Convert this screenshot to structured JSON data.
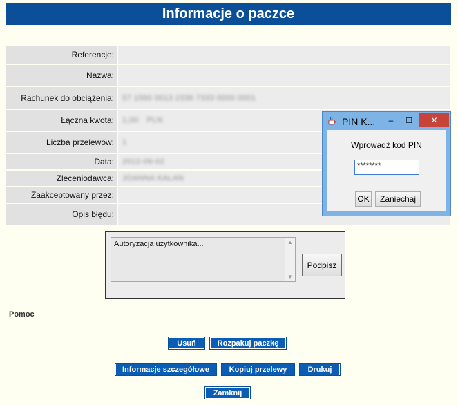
{
  "header": {
    "title": "Informacje o paczce"
  },
  "details": [
    {
      "label": "Referencje:",
      "value": ""
    },
    {
      "label": "Nazwa:",
      "value": ""
    },
    {
      "label": "Rachunek do obciążenia:",
      "value": "57 1560 0013 2336 7333 0000 0001"
    },
    {
      "label": "Łączna kwota:",
      "value": "1,00",
      "currency": "PLN"
    },
    {
      "label": "Liczba przelewów:",
      "value": "1"
    },
    {
      "label": "Data:",
      "value": "2012-06-02"
    },
    {
      "label": "Zleceniodawca:",
      "value": "JOANNA KALAN"
    },
    {
      "label": "Zaakceptowany przez:",
      "value": ""
    },
    {
      "label": "Opis błędu:",
      "value": ""
    }
  ],
  "auth": {
    "status_text": "Autoryzacja użytkownika...",
    "sign_label": "Podpisz"
  },
  "help": {
    "label": "Pomoc"
  },
  "actions": {
    "delete": "Usuń",
    "unpack": "Rozpakuj paczkę",
    "details": "Informacje szczegółowe",
    "copy": "Kopiuj przelewy",
    "print": "Drukuj",
    "close": "Zamknij"
  },
  "pin_dialog": {
    "title": "PIN K...",
    "prompt": "Wprowadź kod PIN",
    "pin_value": "********",
    "ok_label": "OK",
    "cancel_label": "Zaniechaj",
    "minimize_symbol": "‒",
    "maximize_symbol": "☐",
    "close_symbol": "✕"
  },
  "colors": {
    "header_bg": "#0a4f97",
    "button_bg": "#0a5cb5",
    "page_bg": "#fffff1",
    "dialog_frame": "#7eb3e6",
    "close_red": "#c7443b"
  }
}
